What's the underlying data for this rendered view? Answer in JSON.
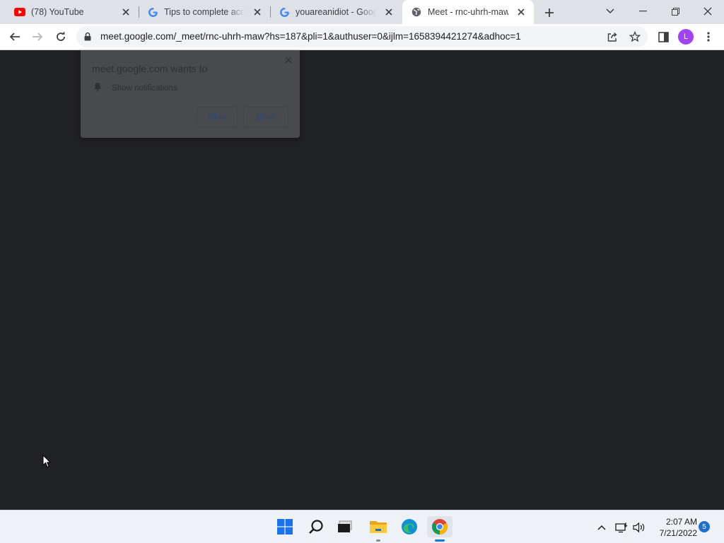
{
  "browser": {
    "tabs": [
      {
        "title": "(78) YouTube",
        "icon": "youtube-icon",
        "active": false
      },
      {
        "title": "Tips to complete account",
        "icon": "google-g-icon",
        "active": false
      },
      {
        "title": "youareanidiot - Google Search",
        "icon": "google-g-icon",
        "active": false
      },
      {
        "title": "Meet - rnc-uhrh-maw",
        "icon": "globe-icon",
        "active": true
      }
    ],
    "url": "meet.google.com/_meet/rnc-uhrh-maw?hs=187&pli=1&authuser=0&ijlm=1658394421274&adhoc=1",
    "profile_initial": "L"
  },
  "permission_popup": {
    "title": "meet.google.com wants to",
    "permission": "Show notifications",
    "allow_label": "Allow",
    "block_label": "Block"
  },
  "taskbar": {
    "time": "2:07 AM",
    "date": "7/21/2022",
    "notification_count": "5"
  },
  "colors": {
    "page_background": "#202124",
    "accent_profile": "#a142f4",
    "tab_strip": "#dee1e6"
  }
}
